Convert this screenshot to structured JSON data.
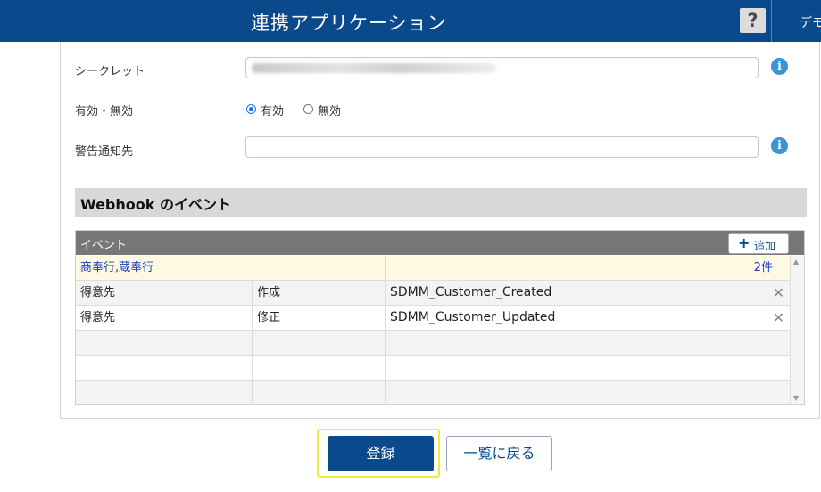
{
  "header": {
    "title": "連携アプリケーション",
    "help_label": "?",
    "user_label": "デモ"
  },
  "form": {
    "secret_label": "シークレット",
    "enabled_label": "有効・無効",
    "enabled_option_on": "有効",
    "enabled_option_off": "無効",
    "enabled_value": "有効",
    "alert_label": "警告通知先",
    "alert_value": "",
    "info_icon": "i"
  },
  "webhook": {
    "section_title": "Webhook のイベント",
    "column_header": "イベント",
    "add_label": "追加",
    "add_icon": "+",
    "group": {
      "name": "商奉行,蔵奉行",
      "count": "2件"
    },
    "rows": [
      {
        "entity": "得意先",
        "action": "作成",
        "event": "SDMM_Customer_Created"
      },
      {
        "entity": "得意先",
        "action": "修正",
        "event": "SDMM_Customer_Updated"
      }
    ],
    "delete_icon": "✕"
  },
  "footer": {
    "register_label": "登録",
    "back_label": "一覧に戻る"
  },
  "colors": {
    "header_bg": "#0a4a8c",
    "grid_header_bg": "#777777",
    "group_row_bg": "#fdf9e3",
    "highlight": "#ecec3a",
    "info_icon": "#3b95d0"
  }
}
